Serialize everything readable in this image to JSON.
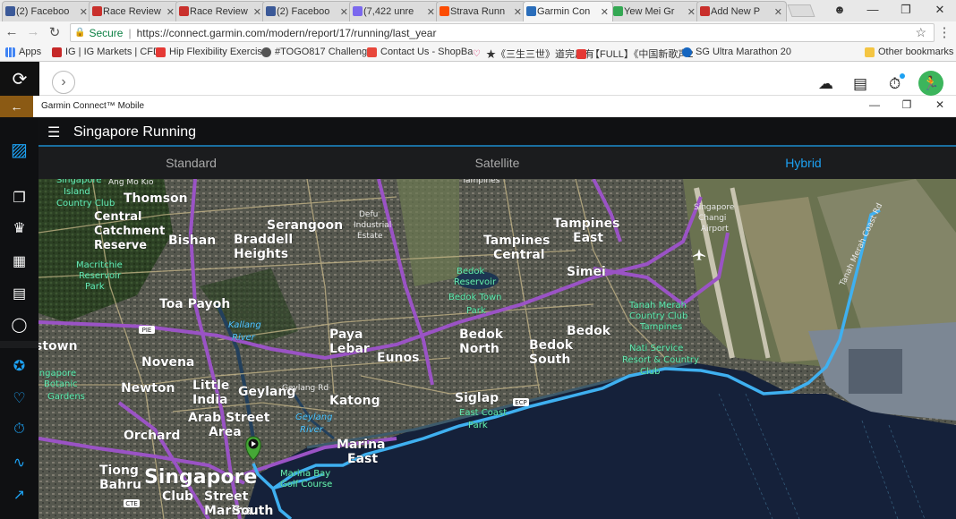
{
  "browser": {
    "tabs": [
      {
        "label": "(2) Faceboo",
        "color": "#3b5998"
      },
      {
        "label": "Race Review",
        "color": "#c9302c"
      },
      {
        "label": "Race Review",
        "color": "#c9302c"
      },
      {
        "label": "(2) Faceboo",
        "color": "#3b5998"
      },
      {
        "label": "(7,422 unre",
        "color": "#7b68ee"
      },
      {
        "label": "Strava Runn",
        "color": "#fc4c02"
      },
      {
        "label": "Garmin Con",
        "color": "#2a6ebb"
      },
      {
        "label": "Yew Mei Gr",
        "color": "#34a853"
      },
      {
        "label": "Add New P",
        "color": "#c9302c"
      }
    ],
    "secure_label": "Secure",
    "url": "https://connect.garmin.com/modern/report/17/running/last_year",
    "bookmarks": {
      "apps": "Apps",
      "b1": "IG | IG Markets | CFD",
      "b2": "Hip Flexibility Exercis",
      "b3": "#TOGO817 Challenge",
      "b4": "Contact Us - ShopBa",
      "b5": "★《三生三世》道完后有",
      "b6": "【FULL】《中国新歌声2",
      "b7": "SG Ultra Marathon 20",
      "other": "Other bookmarks"
    }
  },
  "garmin": {
    "mobile_title": "Garmin Connect™ Mobile",
    "page_title": "Singapore Running",
    "map_tabs": [
      "Standard",
      "Satellite",
      "Hybrid"
    ],
    "active_map_tab": "Hybrid",
    "accent_color": "#1da1f2",
    "avatar_color": "#3cb55c"
  },
  "map": {
    "labels": [
      {
        "text": "Thomson",
        "size": 14
      },
      {
        "text": "Serangoon",
        "size": 14
      },
      {
        "text": "Central",
        "size": 13
      },
      {
        "text": "Catchment",
        "size": 13
      },
      {
        "text": "Reserve",
        "size": 13
      },
      {
        "text": "Bishan",
        "size": 14
      },
      {
        "text": "Braddell",
        "size": 14
      },
      {
        "text": "Heights",
        "size": 14
      },
      {
        "text": "Tampines",
        "size": 14
      },
      {
        "text": "Central",
        "size": 14
      },
      {
        "text": "Tampines",
        "size": 14
      },
      {
        "text": "East",
        "size": 14
      },
      {
        "text": "Simei",
        "size": 14
      },
      {
        "text": "Toa Payoh",
        "size": 14
      },
      {
        "text": "Paya",
        "size": 14
      },
      {
        "text": "Lebar",
        "size": 14
      },
      {
        "text": "Eunos",
        "size": 14
      },
      {
        "text": "Bedok",
        "size": 14
      },
      {
        "text": "North",
        "size": 14
      },
      {
        "text": "Bedok",
        "size": 14
      },
      {
        "text": "Bedok",
        "size": 14
      },
      {
        "text": "South",
        "size": 14
      },
      {
        "text": "Novena",
        "size": 14
      },
      {
        "text": "Newton",
        "size": 14
      },
      {
        "text": "Little",
        "size": 14
      },
      {
        "text": "India",
        "size": 14
      },
      {
        "text": "Geylang",
        "size": 14
      },
      {
        "text": "Katong",
        "size": 14
      },
      {
        "text": "Siglap",
        "size": 14
      },
      {
        "text": "Arab Street",
        "size": 14
      },
      {
        "text": "Area",
        "size": 14
      },
      {
        "text": "Orchard",
        "size": 14
      },
      {
        "text": "Marina",
        "size": 14
      },
      {
        "text": "East",
        "size": 14
      },
      {
        "text": "Tiong",
        "size": 14
      },
      {
        "text": "Bahru",
        "size": 14
      },
      {
        "text": "Singapore",
        "size": 22
      },
      {
        "text": "Club",
        "size": 14
      },
      {
        "text": "Street",
        "size": 14
      },
      {
        "text": "Marina",
        "size": 14
      },
      {
        "text": "South",
        "size": 14
      },
      {
        "text": "stown",
        "size": 14
      }
    ],
    "green_labels": [
      "Bedok",
      "Reservoir",
      "Bedok Town",
      "Park",
      "Tanah Merah",
      "Country Club",
      "Tampines",
      "Nati Service",
      "Resort & Country",
      "Club",
      "East Coast",
      "Park",
      "Marina Bay",
      "Golf Course",
      "Macritchie",
      "Reservoir",
      "Park",
      "ingapore",
      "Botanic",
      "Gardens",
      "Singapore",
      "Island",
      "Country Club"
    ],
    "water_labels": [
      "Kallang",
      "River",
      "Geylang",
      "River"
    ],
    "small_labels": [
      "Defu",
      "Industrial",
      "Estate",
      "Singapore",
      "Changi",
      "Airport",
      "Ang Mo Kio",
      "Tampines",
      "Geylang Rd",
      "Tanah Merah Coast Rd"
    ],
    "road_badges": [
      "PIE",
      "ECP",
      "CTE",
      "PIE"
    ]
  }
}
